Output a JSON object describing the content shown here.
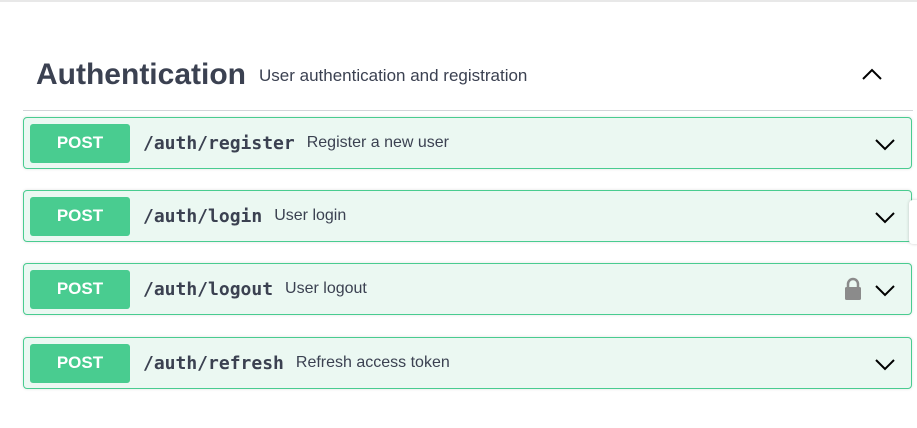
{
  "section": {
    "title": "Authentication",
    "description": "User authentication and registration",
    "expanded_icon": "chevron-up-icon"
  },
  "colors": {
    "post_method": "#49cc90",
    "post_background": "#ebf8f2",
    "text": "#3b4151"
  },
  "operations": [
    {
      "method": "POST",
      "path": "/auth/register",
      "summary": "Register a new user",
      "locked": false,
      "icon": "chevron-down-icon"
    },
    {
      "method": "POST",
      "path": "/auth/login",
      "summary": "User login",
      "locked": false,
      "icon": "chevron-down-icon"
    },
    {
      "method": "POST",
      "path": "/auth/logout",
      "summary": "User logout",
      "locked": true,
      "icon": "chevron-down-icon"
    },
    {
      "method": "POST",
      "path": "/auth/refresh",
      "summary": "Refresh access token",
      "locked": false,
      "icon": "chevron-down-icon"
    }
  ]
}
